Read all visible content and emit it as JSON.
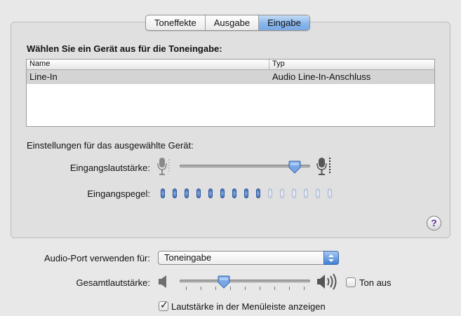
{
  "tabs": [
    {
      "label": "Toneffekte",
      "active": false
    },
    {
      "label": "Ausgabe",
      "active": false
    },
    {
      "label": "Eingabe",
      "active": true
    }
  ],
  "device_section": {
    "heading": "Wählen Sie ein Gerät aus für die Toneingabe:",
    "columns": [
      "Name",
      "Typ"
    ],
    "rows": [
      {
        "name": "Line-In",
        "type": "Audio Line-In-Anschluss",
        "selected": true
      }
    ]
  },
  "settings": {
    "heading": "Einstellungen für das ausgewählte Gerät:",
    "input_volume_label": "Eingangslautstärke:",
    "input_volume_value": 0.92,
    "input_level_label": "Eingangspegel:",
    "input_level_total": 15,
    "input_level_lit": 9
  },
  "help_label": "?",
  "audio_port": {
    "label": "Audio-Port verwenden für:",
    "selected": "Toneingabe"
  },
  "output": {
    "volume_label": "Gesamtlautstärke:",
    "volume_value": 0.32,
    "mute_label": "Ton aus",
    "mute_checked": false,
    "menubar_label": "Lautstärke in der Menüleiste anzeigen",
    "menubar_checked": true
  },
  "colors": {
    "tab_active": "#8ab6ea",
    "level_on": "#3f6db8",
    "level_off": "#c9d4e6",
    "selected_row": "#d4d4d4"
  },
  "icons": {
    "mic_low": "microphone-low-icon",
    "mic_high": "microphone-high-icon",
    "speaker_low": "speaker-low-icon",
    "speaker_high": "speaker-high-icon",
    "help": "help-icon"
  }
}
